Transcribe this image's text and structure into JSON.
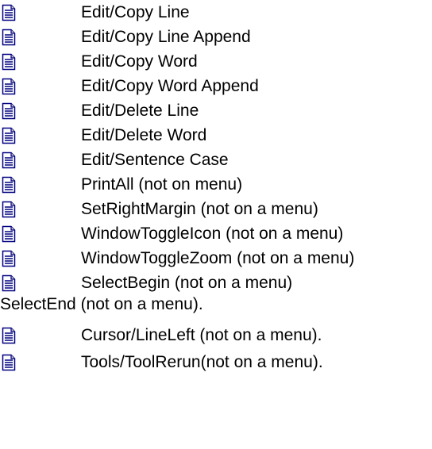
{
  "topics": [
    {
      "label": "Edit/Copy Line",
      "icon": "document-icon"
    },
    {
      "label": "Edit/Copy Line Append",
      "icon": "document-icon"
    },
    {
      "label": "Edit/Copy Word",
      "icon": "document-icon"
    },
    {
      "label": "Edit/Copy Word Append",
      "icon": "document-icon"
    },
    {
      "label": "Edit/Delete Line",
      "icon": "document-icon"
    },
    {
      "label": "Edit/Delete Word",
      "icon": "document-icon"
    },
    {
      "label": "Edit/Sentence Case",
      "icon": "document-icon"
    },
    {
      "label": "PrintAll (not on menu)",
      "icon": "document-icon"
    },
    {
      "label": "SetRightMargin (not on a menu)",
      "icon": "document-icon"
    },
    {
      "label": "WindowToggleIcon (not on a menu)",
      "icon": "document-icon"
    },
    {
      "label": "WindowToggleZoom (not on a menu)",
      "icon": "document-icon"
    },
    {
      "label": "SelectBegin (not on a menu)",
      "icon": "document-icon"
    },
    {
      "label": "Cursor/LineLeft (not on a menu).",
      "icon": "document-icon"
    },
    {
      "label": "Tools/ToolRerun(not on a menu).",
      "icon": "document-icon"
    }
  ],
  "continuation_text": "SelectEnd (not on a menu).",
  "colors": {
    "icon_fill": "#ffffff",
    "icon_outline": "#000080",
    "icon_lines": "#000080",
    "icon_fold": "#c0c0c0"
  }
}
